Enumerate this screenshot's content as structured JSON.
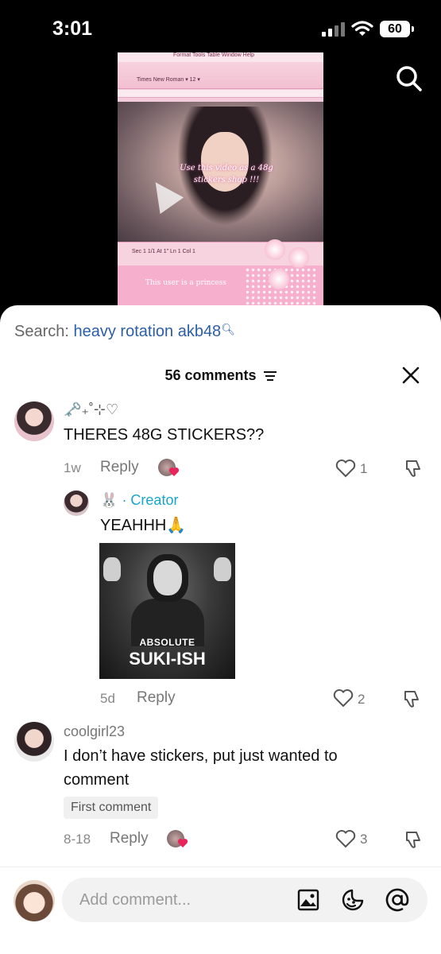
{
  "status_bar": {
    "time": "3:01",
    "battery": "60"
  },
  "video": {
    "menu": "Format  Tools  Table  Window  Help",
    "font": "Times New Roman  ▾  12  ▾",
    "overlay_text": "Use this video as a 48g stickers shop !!!",
    "status": "Sec 1     1/1     At 1\"     Ln 1   Col 1",
    "princess": "This user is a princess"
  },
  "search": {
    "prefix": "Search:",
    "query": "heavy rotation akb48"
  },
  "header": {
    "count": "56 comments"
  },
  "comments": [
    {
      "username": "🗝️₊˚⊹♡",
      "text": "THERES 48G STICKERS??",
      "time": "1w",
      "reply": "Reply",
      "likes": "1"
    },
    {
      "username": "🐰",
      "creator_label": "· Creator",
      "text": "YEAHHH🙏",
      "sticker_line1": "ABSOLUTE",
      "sticker_line2": "SUKI-ISH",
      "time": "5d",
      "reply": "Reply",
      "likes": "2"
    },
    {
      "username": "coolgirl23",
      "text": "I don’t have stickers, put just wanted to comment",
      "badge": "First comment",
      "time": "8-18",
      "reply": "Reply",
      "likes": "3"
    }
  ],
  "composer": {
    "placeholder": "Add comment..."
  },
  "colors": {
    "creator": "#17a6c8",
    "search_query": "#2c5ea8",
    "heart_badge": "#e8245a"
  }
}
